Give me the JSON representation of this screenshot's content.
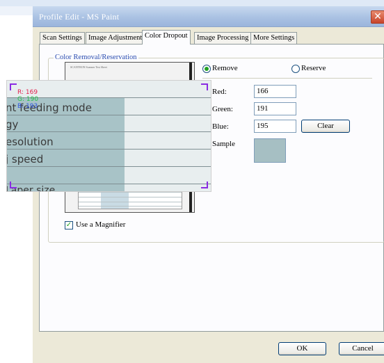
{
  "window": {
    "title": "Profile Edit - MS Paint",
    "close_glyph": "✕"
  },
  "tabs": [
    {
      "label": "Scan Settings"
    },
    {
      "label": "Image Adjustment"
    },
    {
      "label": "Color Dropout"
    },
    {
      "label": "Image Processing"
    },
    {
      "label": "More Settings"
    }
  ],
  "active_tab": "Color Dropout",
  "group": {
    "title": "Color Removal/Reservation"
  },
  "preview": {
    "caption": "SCANTRON Scanner Test Sheet"
  },
  "mode": {
    "remove_label": "Remove",
    "reserve_label": "Reserve",
    "selected": "Remove"
  },
  "fields": {
    "red_label": "Red:",
    "red_value": "166",
    "green_label": "Green:",
    "green_value": "191",
    "blue_label": "Blue:",
    "blue_value": "195",
    "sample_label": "Sample",
    "sample_color": "#a6bfc3"
  },
  "clear_button": "Clear",
  "use_magnifier": {
    "label": "Use a Magnifier",
    "checked": true,
    "glyph": "✓"
  },
  "magnifier": {
    "r": "R: 169",
    "g": "G: 190",
    "b": "B: 193",
    "lines": [
      "nt feeding mode",
      "gy",
      "esolution",
      "j speed",
      "Laper size"
    ]
  },
  "footer": {
    "ok": "OK",
    "cancel": "Cancel"
  },
  "colors": {
    "title_bar": "#aac2e3",
    "accent_blue": "#2a4cb0",
    "check_green": "#21a121",
    "magnifier_border": "#8a2be2"
  }
}
